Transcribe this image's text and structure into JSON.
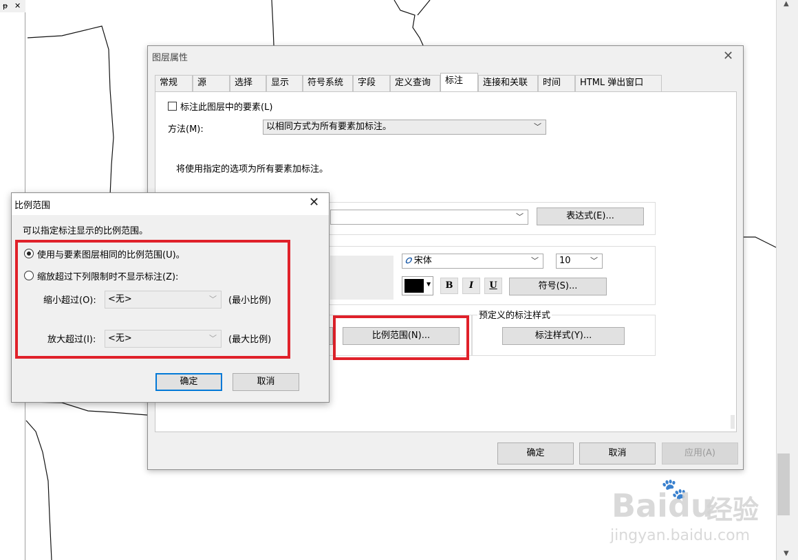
{
  "left_panel": {
    "pin_glyph": "ᵽ",
    "close_glyph": "✕"
  },
  "layer_properties": {
    "title": "图层属性",
    "tabs": [
      "常规",
      "源",
      "选择",
      "显示",
      "符号系统",
      "字段",
      "定义查询",
      "标注",
      "连接和关联",
      "时间",
      "HTML 弹出窗口"
    ],
    "active_tab": "标注",
    "label_features_checkbox": {
      "label": "标注此图层中的要素(L)",
      "checked": false
    },
    "method_label": "方法(M):",
    "method_value": "以相同方式为所有要素加标注。",
    "info_text": "将使用指定的选项为所有要素加标注。",
    "expression_button": "表达式(E)...",
    "font_name": "宋体",
    "font_size": "10",
    "color_swatch": "#000000",
    "bold_label": "B",
    "italic_label": "I",
    "underline_label": "U",
    "symbol_button": "符号(S)...",
    "predefined_styles_label": "预定义的标注样式",
    "scale_range_button": "比例范围(N)...",
    "label_styles_button": "标注样式(Y)...",
    "ok_button": "确定",
    "cancel_button": "取消",
    "apply_button": "应用(A)"
  },
  "scale_range_dialog": {
    "title": "比例范围",
    "description": "可以指定标注显示的比例范围。",
    "option_same": "使用与要素图层相同的比例范围(U)。",
    "option_custom": "缩放超过下列限制时不显示标注(Z):",
    "selected_option": "same",
    "min_scale_label": "缩小超过(O):",
    "min_scale_value": "<无>",
    "min_scale_unit": "(最小比例)",
    "max_scale_label": "放大超过(I):",
    "max_scale_value": "<无>",
    "max_scale_unit": "(最大比例)",
    "ok_button": "确定",
    "cancel_button": "取消"
  },
  "highlight_color": "#e0212a",
  "watermark": {
    "logo_text": "Bai",
    "logo_text2": "du",
    "cn_text": "经验",
    "url_text": "jingyan.baidu.com"
  }
}
